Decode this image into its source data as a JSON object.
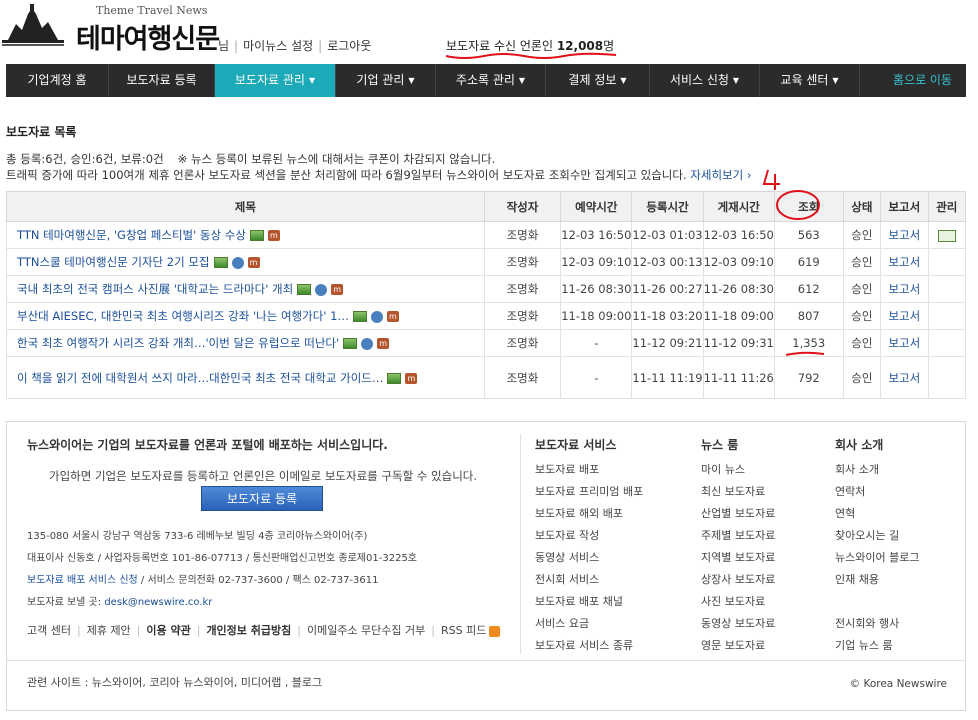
{
  "header": {
    "logo_sub": "Theme Travel News",
    "logo_main": "테마여행신문",
    "user_name": "",
    "user_suffix": "님",
    "my_news": "마이뉴스 설정",
    "logout": "로그아웃",
    "receivers_prefix": "보도자료 수신 언론인",
    "receivers_count": "12,008",
    "receivers_unit": "명"
  },
  "nav": {
    "items": [
      "기업계정 홈",
      "보도자료 등록",
      "보도자료 관리",
      "기업 관리",
      "주소록 관리",
      "결제 정보",
      "서비스 신청",
      "교육 센터"
    ],
    "home": "홈으로 이동",
    "accent": "#1caab8"
  },
  "content": {
    "title": "보도자료 목록",
    "stats": "총 등록:6건, 승인:6건, 보류:0건",
    "stats_note": "※ 뉴스 등록이 보류된 뉴스에 대해서는 쿠폰이 차감되지 않습니다.",
    "notice": "트래픽 증가에 따라 100여개 제휴 언론사 보도자료 섹션을 분산 처리함에 따라 6월9일부터 뉴스와이어 보도자료 조회수만 집계되고 있습니다.",
    "notice_more": "자세히보기 ›"
  },
  "table": {
    "headers": [
      "제목",
      "작성자",
      "예약시간",
      "등록시간",
      "게재시간",
      "조회",
      "상태",
      "보고서",
      "관리"
    ],
    "rows": [
      {
        "title": "TTN 테마여행신문, 'G창업 페스티벌' 동상 수상",
        "author": "조명화",
        "reserve": "12-03 16:50",
        "registered": "12-03 01:03",
        "published": "12-03 16:50",
        "views": "563",
        "status": "승인",
        "report": "보고서",
        "icons": [
          "img",
          "m"
        ],
        "manage": true
      },
      {
        "title": "TTN스쿨 테마여행신문 기자단 2기 모집",
        "author": "조명화",
        "reserve": "12-03 09:10",
        "registered": "12-03 00:13",
        "published": "12-03 09:10",
        "views": "619",
        "status": "승인",
        "report": "보고서",
        "icons": [
          "img",
          "vod",
          "m"
        ],
        "manage": false
      },
      {
        "title": "국내 최초의 전국 캠퍼스 사진展 '대학교는 드라마다' 개최",
        "author": "조명화",
        "reserve": "11-26 08:30",
        "registered": "11-26 00:27",
        "published": "11-26 08:30",
        "views": "612",
        "status": "승인",
        "report": "보고서",
        "icons": [
          "img",
          "vod",
          "m"
        ],
        "manage": false
      },
      {
        "title": "부산대 AIESEC, 대한민국 최초 여행시리즈 강좌 '나는 여행가다' 1…",
        "author": "조명화",
        "reserve": "11-18 09:00",
        "registered": "11-18 03:20",
        "published": "11-18 09:00",
        "views": "807",
        "status": "승인",
        "report": "보고서",
        "icons": [
          "img",
          "vod",
          "m"
        ],
        "manage": false
      },
      {
        "title": "한국 최초 여행작가 시리즈 강좌 개최…'이번 달은 유럽으로 떠난다'",
        "author": "조명화",
        "reserve": "-",
        "registered": "11-12 09:21",
        "published": "11-12 09:31",
        "views": "1,353",
        "status": "승인",
        "report": "보고서",
        "icons": [
          "img",
          "vod",
          "m"
        ],
        "manage": false
      },
      {
        "title": "이 책을 읽기 전에 대학원서 쓰지 마라…대한민국 최초 전국 대학교 가이드…",
        "author": "조명화",
        "reserve": "-",
        "registered": "11-11 11:19",
        "published": "11-11 11:26",
        "views": "792",
        "status": "승인",
        "report": "보고서",
        "icons": [
          "img",
          "m"
        ],
        "manage": false
      }
    ]
  },
  "footer": {
    "intro": "뉴스와이어는 기업의 보도자료를 언론과 포털에 배포하는 서비스입니다.",
    "desc": "가입하면 기업은 보도자료를 등록하고 언론인은 이메일로 보도자료를 구독할 수 있습니다.",
    "button": "보도자료 등록",
    "addr1": "135-080 서울시 강남구 역삼동 733-6 레베누보 빌딩 4층 코리아뉴스와이어(주)",
    "addr2": "대표이사 신동호 / 사업자등록번호 101-86-07713 / 통신판매업신고번호 종로제01-3225호",
    "addr3_link": "보도자료 배포 서비스 신청",
    "addr3_rest": " / 서비스 문의전화 02-737-3600 / 팩스 02-737-3611",
    "addr4_prefix": "보도자료 보낼 곳: ",
    "addr4_email": "desk@newswire.co.kr",
    "links": [
      "고객 센터",
      "제휴 제안",
      "이용 약관",
      "개인정보 취급방침",
      "이메일주소 무단수집 거부",
      "RSS 피드"
    ],
    "col1": {
      "head": "보도자료 서비스",
      "items": [
        "보도자료 배포",
        "보도자료 프리미엄 배포",
        "보도자료 해외 배포",
        "보도자료 작성",
        "동영상 서비스",
        "전시회 서비스",
        "보도자료 배포 채널",
        "서비스 요금",
        "보도자료 서비스 종류"
      ]
    },
    "col2": {
      "head": "뉴스 룸",
      "items": [
        "마이 뉴스",
        "최신 보도자료",
        "산업별 보도자료",
        "주제별 보도자료",
        "지역별 보도자료",
        "상장사 보도자료",
        "사진 보도자료",
        "동영상 보도자료",
        "영문 보도자료"
      ]
    },
    "col3": {
      "head": "회사 소개",
      "items": [
        "회사 소개",
        "연락처",
        "연혁",
        "찾아오시는 길",
        "뉴스와이어 블로그",
        "인재 채용",
        "",
        "전시회와 행사",
        "기업 뉴스 룸"
      ]
    },
    "related": "관련 사이트 : 뉴스와이어, 코리아 뉴스와이어, 미디어랩 , 블로그",
    "copyright": "© Korea Newswire"
  }
}
